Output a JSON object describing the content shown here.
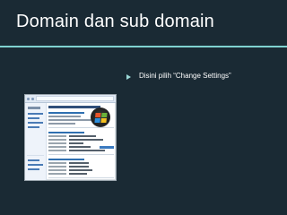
{
  "slide": {
    "title": "Domain dan sub domain",
    "bullet": "Disini pilih “Change Settings”"
  },
  "colors": {
    "background": "#1a2a34",
    "accent": "#7fd2d0",
    "text": "#ffffff"
  },
  "screenshot": {
    "icon": "windows-logo-icon"
  }
}
